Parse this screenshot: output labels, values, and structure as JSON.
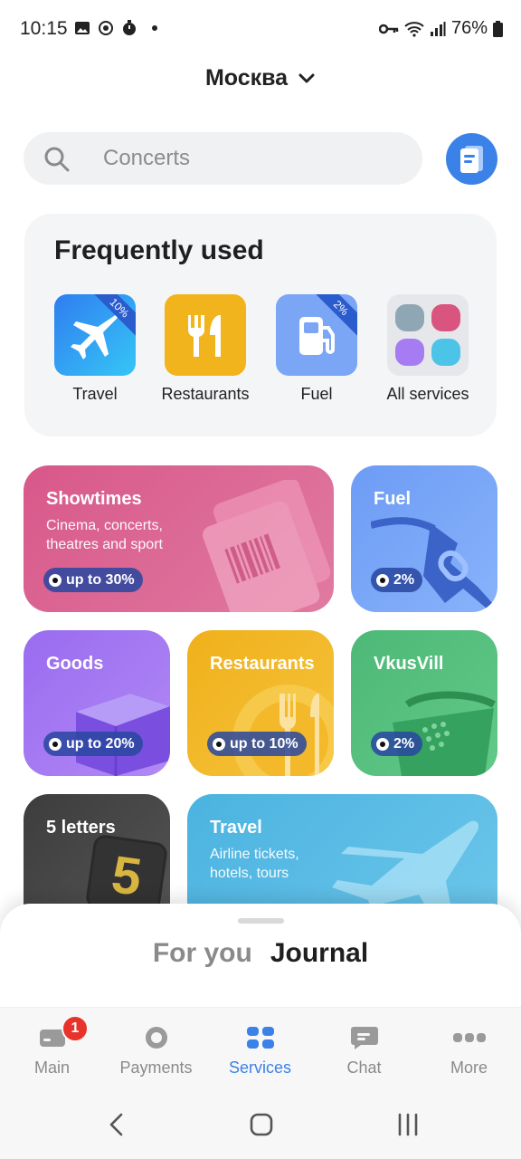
{
  "status_bar": {
    "time": "10:15",
    "battery": "76%"
  },
  "header": {
    "city": "Москва"
  },
  "search": {
    "placeholder": "Concerts"
  },
  "frequently_used": {
    "title": "Frequently used",
    "items": [
      {
        "label": "Travel",
        "badge": "10%",
        "icon": "airplane-icon"
      },
      {
        "label": "Restaurants",
        "icon": "cutlery-icon"
      },
      {
        "label": "Fuel",
        "badge": "2%",
        "icon": "fuel-pump-icon"
      },
      {
        "label": "All services",
        "icon": "grid-icon"
      }
    ]
  },
  "cards": {
    "showtimes": {
      "title": "Showtimes",
      "subtitle_line1": "Cinema, concerts,",
      "subtitle_line2": "theatres and sport",
      "badge": "up to 30%"
    },
    "fuel": {
      "title": "Fuel",
      "badge": "2%"
    },
    "goods": {
      "title": "Goods",
      "badge": "up to 20%"
    },
    "restaurants": {
      "title": "Restaurants",
      "badge": "up to 10%"
    },
    "vkusvill": {
      "title": "VkusVill",
      "badge": "2%"
    },
    "five_letters": {
      "title": "5 letters",
      "digit": "5"
    },
    "travel": {
      "title": "Travel",
      "subtitle_line1": "Airline tickets,",
      "subtitle_line2": "hotels, tours"
    }
  },
  "sheet": {
    "tab_for_you": "For you",
    "tab_journal": "Journal"
  },
  "nav": {
    "main": "Main",
    "main_badge": "1",
    "payments": "Payments",
    "services": "Services",
    "chat": "Chat",
    "more": "More"
  },
  "colors": {
    "accent": "#3b82e8",
    "showtimes": "#d85c8c",
    "fuel": "#6f9ff5",
    "goods": "#9c6ef0",
    "restaurants": "#f2b41c",
    "vkusvill": "#4fbd79",
    "five_letters": "#4a4a4a",
    "travel": "#4fb6e2"
  }
}
